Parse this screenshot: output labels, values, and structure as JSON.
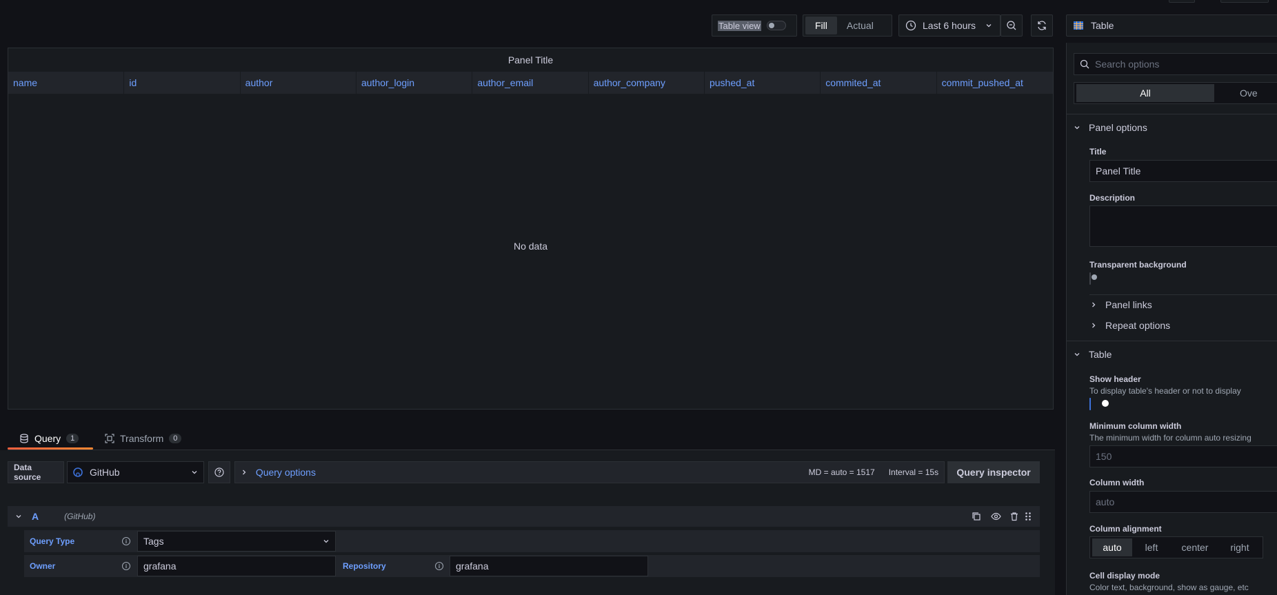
{
  "toolbar": {
    "table_view_label": "Table view",
    "fill_label": "Fill",
    "actual_label": "Actual",
    "time_range_label": "Last 6 hours",
    "visualization_label": "Table"
  },
  "panel": {
    "title": "Panel Title",
    "columns": [
      "name",
      "id",
      "author",
      "author_login",
      "author_email",
      "author_company",
      "pushed_at",
      "commited_at",
      "commit_pushed_at"
    ],
    "empty_text": "No data"
  },
  "query_tabs": {
    "query_label": "Query",
    "query_count": "1",
    "transform_label": "Transform",
    "transform_count": "0"
  },
  "query_bar": {
    "data_source_label": "Data source",
    "data_source_value": "GitHub",
    "query_options_label": "Query options",
    "md_info": "MD = auto = 1517",
    "interval_info": "Interval = 15s",
    "inspector_label": "Query inspector"
  },
  "query_a": {
    "ref_id": "A",
    "source_hint": "(GitHub)",
    "query_type_label": "Query Type",
    "query_type_value": "Tags",
    "owner_label": "Owner",
    "owner_value": "grafana",
    "repository_label": "Repository",
    "repository_value": "grafana"
  },
  "sidebar": {
    "search_placeholder": "Search options",
    "tab_all": "All",
    "tab_overrides": "Ove",
    "panel_options_label": "Panel options",
    "title_label": "Title",
    "title_value": "Panel Title",
    "description_label": "Description",
    "transparent_label": "Transparent background",
    "panel_links_label": "Panel links",
    "repeat_options_label": "Repeat options",
    "table_section_label": "Table",
    "show_header_label": "Show header",
    "show_header_desc": "To display table's header or not to display",
    "min_col_width_label": "Minimum column width",
    "min_col_width_desc": "The minimum width for column auto resizing",
    "min_col_width_placeholder": "150",
    "col_width_label": "Column width",
    "col_width_placeholder": "auto",
    "col_align_label": "Column alignment",
    "align_options": [
      "auto",
      "left",
      "center",
      "right"
    ],
    "cell_display_label": "Cell display mode",
    "cell_display_desc": "Color text, background, show as gauge, etc"
  }
}
